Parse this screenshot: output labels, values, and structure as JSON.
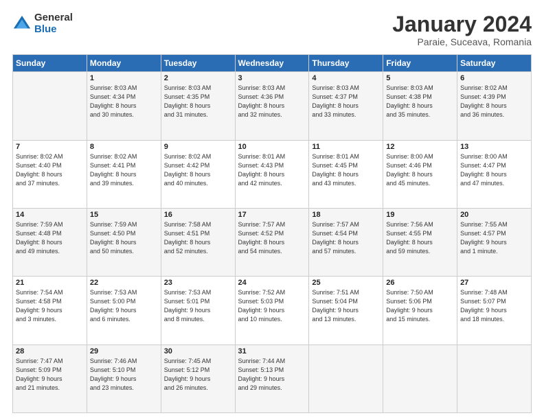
{
  "logo": {
    "general": "General",
    "blue": "Blue"
  },
  "header": {
    "title": "January 2024",
    "subtitle": "Paraie, Suceava, Romania"
  },
  "weekdays": [
    "Sunday",
    "Monday",
    "Tuesday",
    "Wednesday",
    "Thursday",
    "Friday",
    "Saturday"
  ],
  "weeks": [
    [
      {
        "day": "",
        "info": ""
      },
      {
        "day": "1",
        "info": "Sunrise: 8:03 AM\nSunset: 4:34 PM\nDaylight: 8 hours\nand 30 minutes."
      },
      {
        "day": "2",
        "info": "Sunrise: 8:03 AM\nSunset: 4:35 PM\nDaylight: 8 hours\nand 31 minutes."
      },
      {
        "day": "3",
        "info": "Sunrise: 8:03 AM\nSunset: 4:36 PM\nDaylight: 8 hours\nand 32 minutes."
      },
      {
        "day": "4",
        "info": "Sunrise: 8:03 AM\nSunset: 4:37 PM\nDaylight: 8 hours\nand 33 minutes."
      },
      {
        "day": "5",
        "info": "Sunrise: 8:03 AM\nSunset: 4:38 PM\nDaylight: 8 hours\nand 35 minutes."
      },
      {
        "day": "6",
        "info": "Sunrise: 8:02 AM\nSunset: 4:39 PM\nDaylight: 8 hours\nand 36 minutes."
      }
    ],
    [
      {
        "day": "7",
        "info": "Sunrise: 8:02 AM\nSunset: 4:40 PM\nDaylight: 8 hours\nand 37 minutes."
      },
      {
        "day": "8",
        "info": "Sunrise: 8:02 AM\nSunset: 4:41 PM\nDaylight: 8 hours\nand 39 minutes."
      },
      {
        "day": "9",
        "info": "Sunrise: 8:02 AM\nSunset: 4:42 PM\nDaylight: 8 hours\nand 40 minutes."
      },
      {
        "day": "10",
        "info": "Sunrise: 8:01 AM\nSunset: 4:43 PM\nDaylight: 8 hours\nand 42 minutes."
      },
      {
        "day": "11",
        "info": "Sunrise: 8:01 AM\nSunset: 4:45 PM\nDaylight: 8 hours\nand 43 minutes."
      },
      {
        "day": "12",
        "info": "Sunrise: 8:00 AM\nSunset: 4:46 PM\nDaylight: 8 hours\nand 45 minutes."
      },
      {
        "day": "13",
        "info": "Sunrise: 8:00 AM\nSunset: 4:47 PM\nDaylight: 8 hours\nand 47 minutes."
      }
    ],
    [
      {
        "day": "14",
        "info": "Sunrise: 7:59 AM\nSunset: 4:48 PM\nDaylight: 8 hours\nand 49 minutes."
      },
      {
        "day": "15",
        "info": "Sunrise: 7:59 AM\nSunset: 4:50 PM\nDaylight: 8 hours\nand 50 minutes."
      },
      {
        "day": "16",
        "info": "Sunrise: 7:58 AM\nSunset: 4:51 PM\nDaylight: 8 hours\nand 52 minutes."
      },
      {
        "day": "17",
        "info": "Sunrise: 7:57 AM\nSunset: 4:52 PM\nDaylight: 8 hours\nand 54 minutes."
      },
      {
        "day": "18",
        "info": "Sunrise: 7:57 AM\nSunset: 4:54 PM\nDaylight: 8 hours\nand 57 minutes."
      },
      {
        "day": "19",
        "info": "Sunrise: 7:56 AM\nSunset: 4:55 PM\nDaylight: 8 hours\nand 59 minutes."
      },
      {
        "day": "20",
        "info": "Sunrise: 7:55 AM\nSunset: 4:57 PM\nDaylight: 9 hours\nand 1 minute."
      }
    ],
    [
      {
        "day": "21",
        "info": "Sunrise: 7:54 AM\nSunset: 4:58 PM\nDaylight: 9 hours\nand 3 minutes."
      },
      {
        "day": "22",
        "info": "Sunrise: 7:53 AM\nSunset: 5:00 PM\nDaylight: 9 hours\nand 6 minutes."
      },
      {
        "day": "23",
        "info": "Sunrise: 7:53 AM\nSunset: 5:01 PM\nDaylight: 9 hours\nand 8 minutes."
      },
      {
        "day": "24",
        "info": "Sunrise: 7:52 AM\nSunset: 5:03 PM\nDaylight: 9 hours\nand 10 minutes."
      },
      {
        "day": "25",
        "info": "Sunrise: 7:51 AM\nSunset: 5:04 PM\nDaylight: 9 hours\nand 13 minutes."
      },
      {
        "day": "26",
        "info": "Sunrise: 7:50 AM\nSunset: 5:06 PM\nDaylight: 9 hours\nand 15 minutes."
      },
      {
        "day": "27",
        "info": "Sunrise: 7:48 AM\nSunset: 5:07 PM\nDaylight: 9 hours\nand 18 minutes."
      }
    ],
    [
      {
        "day": "28",
        "info": "Sunrise: 7:47 AM\nSunset: 5:09 PM\nDaylight: 9 hours\nand 21 minutes."
      },
      {
        "day": "29",
        "info": "Sunrise: 7:46 AM\nSunset: 5:10 PM\nDaylight: 9 hours\nand 23 minutes."
      },
      {
        "day": "30",
        "info": "Sunrise: 7:45 AM\nSunset: 5:12 PM\nDaylight: 9 hours\nand 26 minutes."
      },
      {
        "day": "31",
        "info": "Sunrise: 7:44 AM\nSunset: 5:13 PM\nDaylight: 9 hours\nand 29 minutes."
      },
      {
        "day": "",
        "info": ""
      },
      {
        "day": "",
        "info": ""
      },
      {
        "day": "",
        "info": ""
      }
    ]
  ]
}
